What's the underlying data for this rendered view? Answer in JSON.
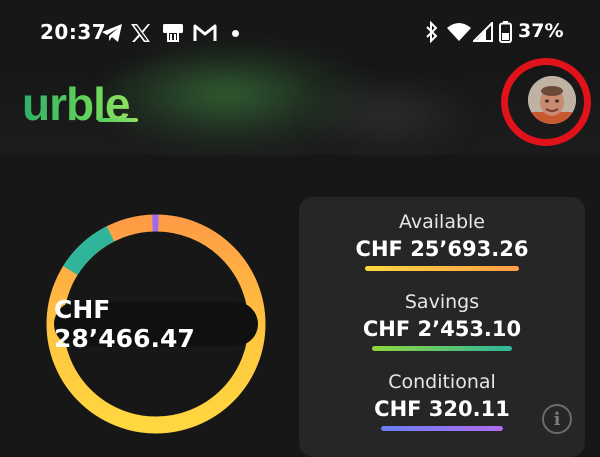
{
  "status_bar": {
    "time": "20:37",
    "battery_percent": "37%",
    "icons": [
      "telegram-icon",
      "x-icon",
      "printer-icon",
      "gmail-icon",
      "notification-dot",
      "bluetooth-icon",
      "wifi-icon",
      "signal-icon",
      "battery-icon"
    ]
  },
  "header": {
    "logo_text": "urble",
    "avatar": "profile-avatar"
  },
  "balance": {
    "total": "CHF 28’466.47",
    "available": {
      "label": "Available",
      "amount": "CHF 25’693.26",
      "color": "#ffb347"
    },
    "savings": {
      "label": "Savings",
      "amount": "CHF 2’453.10",
      "color": "#2fb69a"
    },
    "conditional": {
      "label": "Conditional",
      "amount": "CHF 320.11",
      "color": "#9b6cf0"
    }
  },
  "colors": {
    "brand_green": "#3ec15a",
    "highlight_red": "#e0121a",
    "background": "#171717",
    "card": "#262626"
  }
}
